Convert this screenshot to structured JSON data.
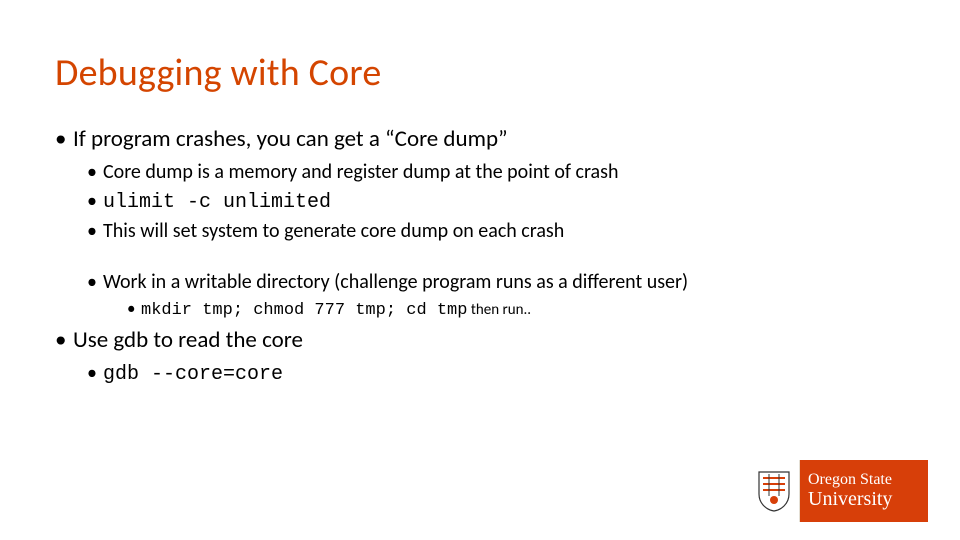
{
  "title": "Debugging with Core",
  "b1": "If program crashes, you can get a “Core dump”",
  "b1a": "Core dump is a memory and register dump at the point of crash",
  "b1b": "ulimit -c unlimited",
  "b1c": "This will set system to generate core dump on each crash",
  "b1d": "Work in a writable directory (challenge program runs as a different user)",
  "b1d1_mono": "mkdir tmp; chmod 777 tmp; cd tmp",
  "b1d1_tail": " then run..",
  "b2": "Use gdb to read the core",
  "b2a": "gdb --core=core",
  "logo": {
    "line1": "Oregon State",
    "line2": "University"
  }
}
